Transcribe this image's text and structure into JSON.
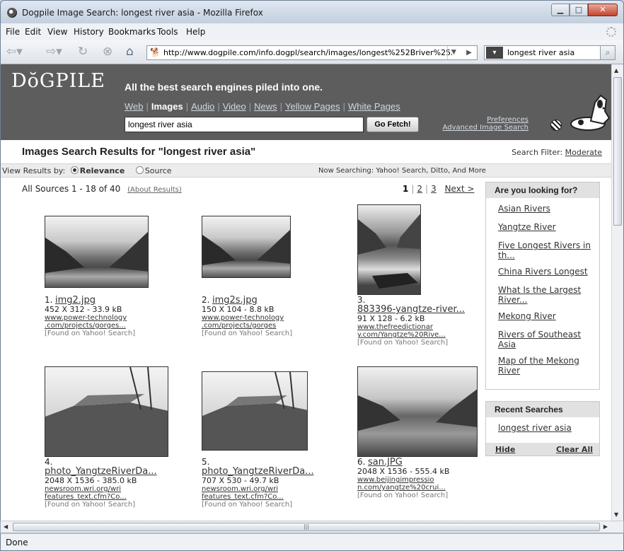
{
  "window": {
    "title": "Dogpile Image Search: longest river asia - Mozilla Firefox"
  },
  "menu": [
    "File",
    "Edit",
    "View",
    "History",
    "Bookmarks",
    "Tools",
    "Help"
  ],
  "nav": {
    "url": "http://www.dogpile.com/info.dogpl/search/images/longest%252Briver%252",
    "search_value": "longest river asia"
  },
  "header": {
    "logo": "DŏGPILE",
    "tagline": "All the best search engines piled into one.",
    "tabs": [
      "Web",
      "Images",
      "Audio",
      "Video",
      "News",
      "Yellow Pages",
      "White Pages"
    ],
    "active_tab": "Images",
    "query": "longest river asia",
    "fetch_label": "Go Fetch!",
    "preferences": "Preferences",
    "advanced": "Advanced Image Search"
  },
  "results_header": {
    "title": "Images Search Results for \"longest river asia\"",
    "filter_label": "Search Filter:",
    "filter_value": "Moderate",
    "view_by": "View Results by:",
    "opt_relevance": "Relevance",
    "opt_source": "Source",
    "now_searching": "Now Searching: Yahoo! Search, Ditto, And More",
    "counts": "All Sources  1 - 18 of 40",
    "about": "(About Results)",
    "pages": [
      "1",
      "2",
      "3"
    ],
    "next": "Next >"
  },
  "results": [
    {
      "num": "1.",
      "name": "img2.jpg",
      "dims": "452 X 312 - 33.9 kB",
      "src1": "www.power-technology",
      "src2": ".com/projects/gorges...",
      "found": "[Found on Yahoo! Search]"
    },
    {
      "num": "2.",
      "name": "img2s.jpg",
      "dims": "150 X 104 - 8.8 kB",
      "src1": "www.power-technology",
      "src2": ".com/projects/gorges",
      "found": "[Found on Yahoo! Search]"
    },
    {
      "num": "3.",
      "name": "883396-yangtze-river...",
      "dims": "91 X 128 - 6.2 kB",
      "src1": "www.thefreedictionar",
      "src2": "y.com/Yangtze%20Rive...",
      "found": "[Found on Yahoo! Search]"
    },
    {
      "num": "4.",
      "name": "photo_YangtzeRiverDa...",
      "dims": "2048 X 1536 - 385.0 kB",
      "src1": "newsroom.wri.org/wri",
      "src2": "features_text.cfm?Co...",
      "found": "[Found on Yahoo! Search]"
    },
    {
      "num": "5.",
      "name": "photo_YangtzeRiverDa...",
      "dims": "707 X 530 - 49.7 kB",
      "src1": "newsroom.wri.org/wri",
      "src2": "features_text.cfm?Co...",
      "found": "[Found on Yahoo! Search]"
    },
    {
      "num": "6.",
      "name": "san.JPG",
      "dims": "2048 X 1536 - 555.4 kB",
      "src1": "www.beijingimpressio",
      "src2": "n.com/yangtze%20crui...",
      "found": "[Found on Yahoo! Search]"
    }
  ],
  "sidebar": {
    "looking_title": "Are you looking for?",
    "looking": [
      "Asian Rivers",
      "Yangtze River",
      "Five Longest Rivers in th...",
      "China Rivers Longest",
      "What Is the Largest River...",
      "Mekong River",
      "Rivers of Southeast Asia",
      "Map of the Mekong River"
    ],
    "recent_title": "Recent Searches",
    "recent": [
      "longest river asia"
    ],
    "hide": "Hide",
    "clear_all": "Clear All"
  },
  "status": {
    "text": "Done"
  }
}
